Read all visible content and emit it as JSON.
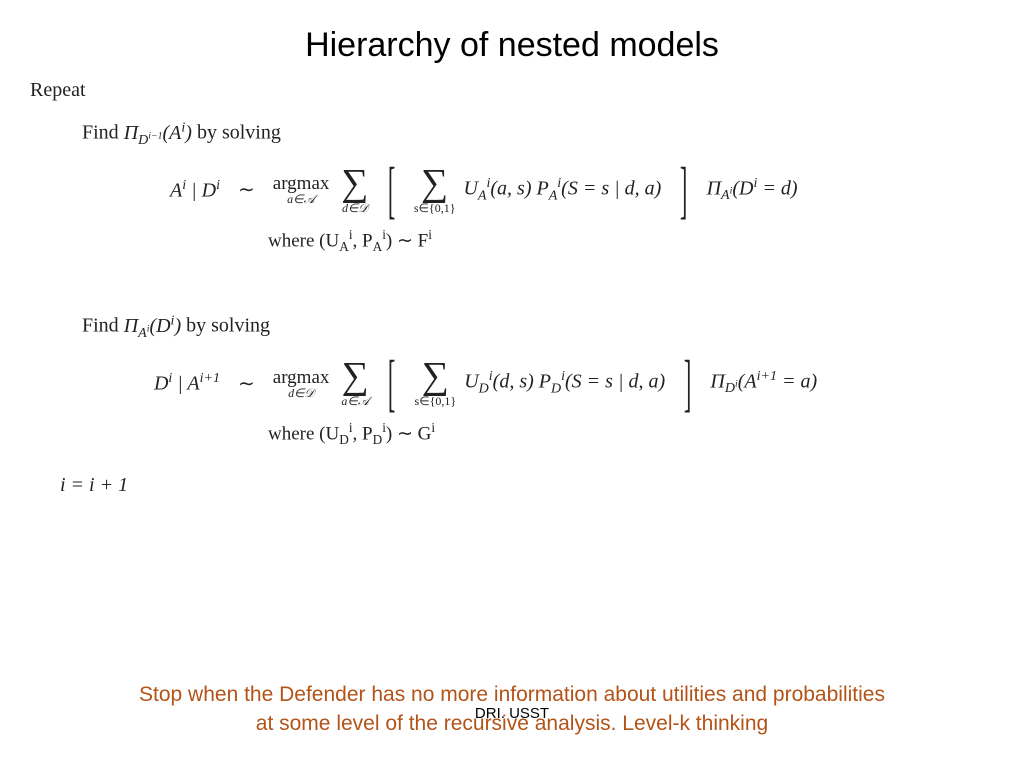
{
  "title": "Hierarchy of nested models",
  "repeat_label": "Repeat",
  "block1": {
    "find_prefix": "Find ",
    "find_expr_html": "Π<sub>D<sup>i−1</sup></sub>(A<sup>i</sup>)",
    "find_suffix": " by solving",
    "lhs_html": "A<sup>i</sup> | D<sup>i</sup>",
    "tilde": "∼",
    "argmax_top": "argmax",
    "argmax_sub_html": "a∈𝒜",
    "sum1_under_html": "d∈𝒟",
    "sum2_under_html": "s∈{0,1}",
    "inside_html": "U<sub>A</sub><sup>i</sup>(a, s)&nbsp;P<sub>A</sub><sup>i</sup>(S = s | d, a)",
    "tail_html": "Π<sub>A<sup>i</sup></sub>(D<sup>i</sup> = d)",
    "where_html": "where (U<sub>A</sub><sup>i</sup>, P<sub>A</sub><sup>i</sup>) ∼ F<sup>i</sup>"
  },
  "block2": {
    "find_prefix": "Find ",
    "find_expr_html": "Π<sub>A<sup>i</sup></sub>(D<sup>i</sup>)",
    "find_suffix": " by solving",
    "lhs_html": "D<sup>i</sup> | A<sup>i+1</sup>",
    "tilde": "∼",
    "argmax_top": "argmax",
    "argmax_sub_html": "d∈𝒟",
    "sum1_under_html": "a∈𝒜",
    "sum2_under_html": "s∈{0,1}",
    "inside_html": "U<sub>D</sub><sup>i</sup>(d, s)&nbsp;P<sub>D</sub><sup>i</sup>(S = s | d, a)",
    "tail_html": "Π<sub>D<sup>i</sup></sub>(A<sup>i+1</sup> = a)",
    "where_html": "where (U<sub>D</sub><sup>i</sup>, P<sub>D</sub><sup>i</sup>) ∼ G<sup>i</sup>"
  },
  "increment": "i = i + 1",
  "footer_line1": "Stop when the Defender has no more information about utilities and probabilities",
  "footer_line2": "at some level of the recursive analysis. Level-k  thinking",
  "page_marker": "DRI. USST"
}
